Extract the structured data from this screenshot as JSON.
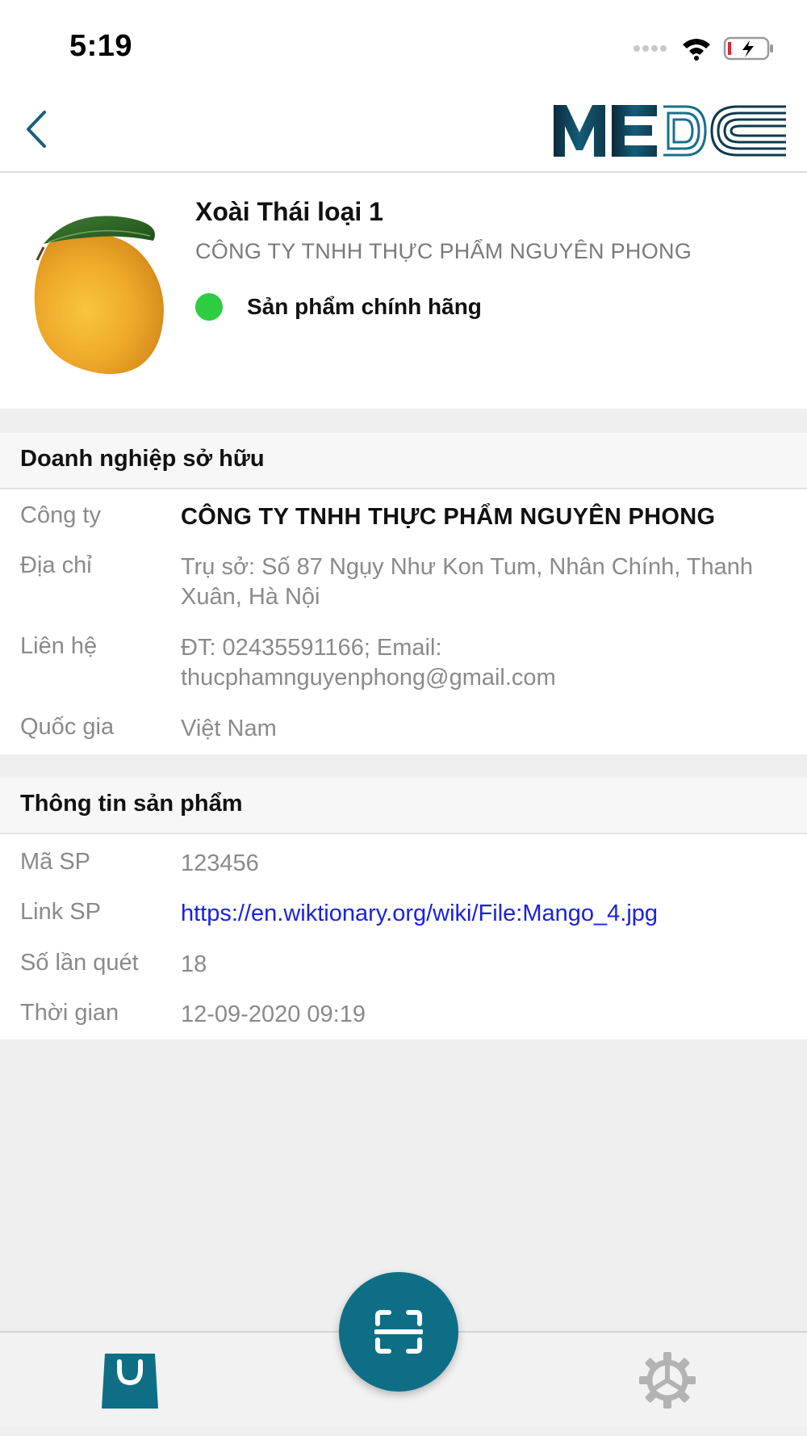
{
  "status_bar": {
    "time": "5:19"
  },
  "nav": {
    "logo_text": "MEDC"
  },
  "product": {
    "name": "Xoài Thái loại 1",
    "company": "CÔNG TY TNHH THỰC PHẨM NGUYÊN PHONG",
    "authenticity": "Sản phẩm chính hãng",
    "authenticity_color": "#2ecc40"
  },
  "owner_section": {
    "title": "Doanh nghiệp sở hữu",
    "rows": [
      {
        "label": "Công ty",
        "value": "CÔNG TY TNHH THỰC PHẨM NGUYÊN PHONG"
      },
      {
        "label": "Địa chỉ",
        "value": "Trụ sở: Số 87  Ngụy Như Kon Tum, Nhân Chính, Thanh Xuân, Hà Nội"
      },
      {
        "label": "Liên hệ",
        "value": "ĐT: 02435591166; Email: thucphamnguyenphong@gmail.com"
      },
      {
        "label": "Quốc gia",
        "value": "Việt Nam"
      }
    ]
  },
  "product_section": {
    "title": "Thông tin sản phẩm",
    "rows": [
      {
        "label": "Mã SP",
        "value": "123456"
      },
      {
        "label": "Link SP",
        "value": "https://en.wiktionary.org/wiki/File:Mango_4.jpg"
      },
      {
        "label": "Số lần quét",
        "value": "18"
      },
      {
        "label": "Thời gian",
        "value": "12-09-2020 09:19"
      }
    ]
  },
  "tab_bar": {
    "left_icon": "shopping-bag-icon",
    "center_icon": "scan-icon",
    "right_icon": "gear-icon"
  },
  "colors": {
    "brand": "#0e6e86",
    "link": "#1a22e0"
  }
}
